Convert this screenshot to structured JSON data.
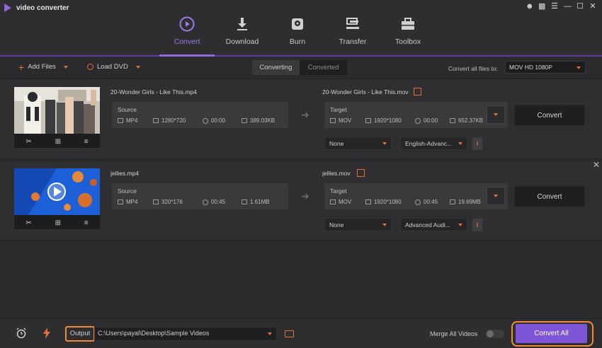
{
  "app": {
    "title": "video converter"
  },
  "window_controls": [
    "user-icon",
    "chat-icon",
    "menu-icon",
    "minimize-icon",
    "maximize-icon",
    "close-icon"
  ],
  "nav": {
    "items": [
      {
        "label": "Convert",
        "icon": "convert-icon",
        "active": true
      },
      {
        "label": "Download",
        "icon": "download-icon",
        "active": false
      },
      {
        "label": "Burn",
        "icon": "burn-icon",
        "active": false
      },
      {
        "label": "Transfer",
        "icon": "transfer-icon",
        "active": false
      },
      {
        "label": "Toolbox",
        "icon": "toolbox-icon",
        "active": false
      }
    ]
  },
  "toolbar": {
    "add_files": "Add Files",
    "load_dvd": "Load DVD",
    "tabs": [
      "Converting",
      "Converted"
    ],
    "active_tab": "Converting",
    "convert_all_label": "Convert all files to:",
    "convert_all_format": "MOV HD 1080P"
  },
  "files": [
    {
      "source_name": "20-Wonder Girls - Like This.mp4",
      "target_name": "20-Wonder Girls - Like This.mov",
      "source": {
        "label": "Source",
        "format": "MP4",
        "resolution": "1280*720",
        "duration": "00:00",
        "size": "389.03KB"
      },
      "target": {
        "label": "Target",
        "format": "MOV",
        "resolution": "1920*1080",
        "duration": "00:00",
        "size": "652.37KB"
      },
      "subtitle": "None",
      "audio": "English-Advanc...",
      "convert_label": "Convert"
    },
    {
      "source_name": "jellies.mp4",
      "target_name": "jellies.mov",
      "source": {
        "label": "Source",
        "format": "MP4",
        "resolution": "320*176",
        "duration": "00:45",
        "size": "1.61MB"
      },
      "target": {
        "label": "Target",
        "format": "MOV",
        "resolution": "1920*1080",
        "duration": "00:45",
        "size": "19.69MB"
      },
      "subtitle": "None",
      "audio": "Advanced Audi...",
      "convert_label": "Convert"
    }
  ],
  "bottom": {
    "output_label": "Output",
    "output_path": "C:\\Users\\payal\\Desktop\\Sample Videos",
    "merge_label": "Merge All Videos",
    "merge_on": false,
    "convert_all_button": "Convert All"
  },
  "colors": {
    "accent": "#8e6ad8",
    "orange": "#e0703a",
    "highlight": "#f08a3a",
    "button": "#7e55d6"
  }
}
